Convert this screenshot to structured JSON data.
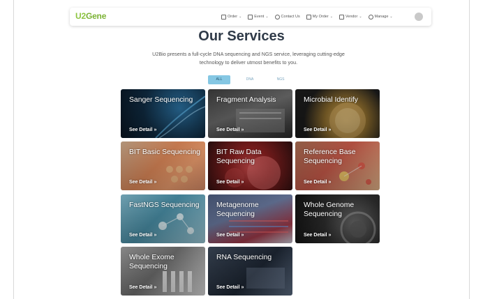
{
  "brand": {
    "u2": "U2",
    "gene": "Gene"
  },
  "nav": [
    {
      "label": "Order",
      "icon": "document-icon"
    },
    {
      "label": "Event",
      "icon": "calendar-icon"
    },
    {
      "label": "Contact Us",
      "icon": "help-circle-icon"
    },
    {
      "label": "My Order",
      "icon": "bag-icon"
    },
    {
      "label": "Vendor",
      "icon": "bag-icon"
    },
    {
      "label": "Manage",
      "icon": "people-icon"
    }
  ],
  "page": {
    "title": "Our Services",
    "intro": "U2Bio presents a full-cycle DNA sequencing and NGS service, leveraging cutting-edge technology to deliver utmost benefits to you."
  },
  "filters": [
    {
      "label": "ALL",
      "active": true
    },
    {
      "label": "DNA",
      "active": false
    },
    {
      "label": "NGS",
      "active": false
    }
  ],
  "detail_label": "See Detail",
  "detail_arrow": "»",
  "services": [
    {
      "title": "Sanger Sequencing"
    },
    {
      "title": "Fragment Analysis"
    },
    {
      "title": "Microbial Identify"
    },
    {
      "title": "BIT Basic Sequencing"
    },
    {
      "title": "BIT Raw Data Sequencing"
    },
    {
      "title": "Reference Base Sequencing"
    },
    {
      "title": "FastNGS Sequencing"
    },
    {
      "title": "Metagenome Sequencing"
    },
    {
      "title": "Whole Genome Sequencing"
    },
    {
      "title": "Whole Exome Sequencing"
    },
    {
      "title": "RNA Sequencing"
    }
  ]
}
